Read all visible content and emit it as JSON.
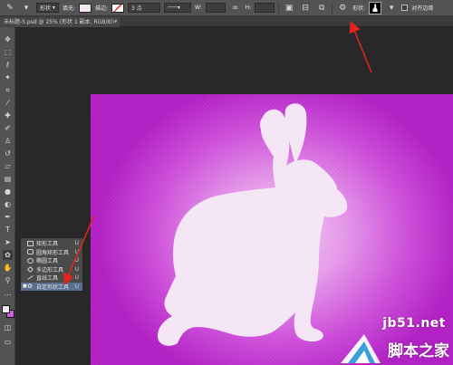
{
  "options_bar": {
    "mode_label": "形状",
    "fill_label": "填充:",
    "stroke_label": "描边:",
    "stroke_width": "3 点",
    "w_label": "W:",
    "h_label": "H:",
    "shape_label": "形状:",
    "align_edges_label": "对齐边缘",
    "fill_color": "#f4e6f5",
    "stroke_color": "#ffffff"
  },
  "document": {
    "tab_title": "未标题-5.psd @ 25% (形状 1 副本, RGB/8) *",
    "close": "×"
  },
  "flyout": {
    "items": [
      {
        "label": "矩形工具",
        "key": "U",
        "icon": "rectangle-icon",
        "selected": false
      },
      {
        "label": "圆角矩形工具",
        "key": "U",
        "icon": "rounded-rectangle-icon",
        "selected": false
      },
      {
        "label": "椭圆工具",
        "key": "U",
        "icon": "ellipse-icon",
        "selected": false
      },
      {
        "label": "多边形工具",
        "key": "U",
        "icon": "polygon-icon",
        "selected": false
      },
      {
        "label": "直线工具",
        "key": "U",
        "icon": "line-icon",
        "selected": false
      },
      {
        "label": "自定形状工具",
        "key": "U",
        "icon": "custom-shape-icon",
        "selected": true
      }
    ]
  },
  "colors": {
    "foreground": "#f2e7f3",
    "background": "#d35ed9",
    "arrow": "#e0241b"
  },
  "watermark": {
    "url": "jb51.net",
    "name": "脚本之家"
  }
}
